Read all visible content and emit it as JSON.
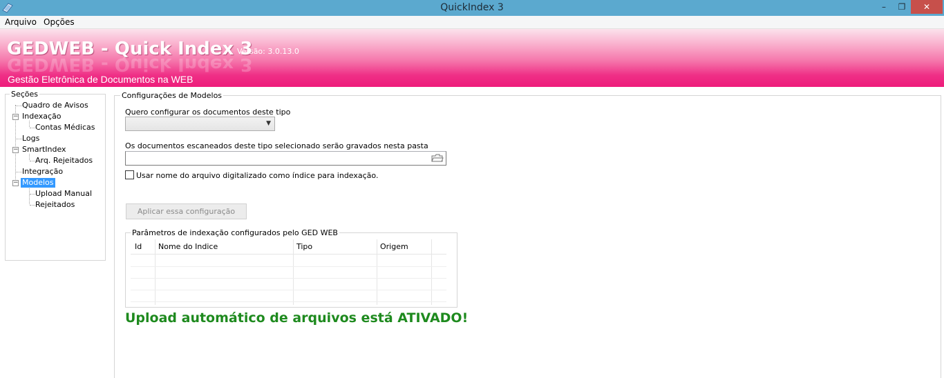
{
  "window": {
    "title": "QuickIndex 3",
    "minimize_glyph": "–",
    "maximize_glyph": "❐",
    "close_glyph": "✕"
  },
  "menu": {
    "arquivo": "Arquivo",
    "opcoes": "Opções"
  },
  "banner": {
    "title": "GEDWEB - Quick Index 3",
    "version": "Versão:  3.0.13.0",
    "subtitle": "Gestão Eletrônica de Documentos na WEB"
  },
  "sidebar": {
    "legend": "Seções",
    "items": [
      {
        "label": "Quadro de Avisos"
      },
      {
        "label": "Indexação",
        "expander": "−"
      },
      {
        "label": "Contas Médicas"
      },
      {
        "label": "Logs"
      },
      {
        "label": "SmartIndex",
        "expander": "−"
      },
      {
        "label": "Arq. Rejeitados"
      },
      {
        "label": "Integração"
      },
      {
        "label": "Modelos",
        "expander": "−",
        "selected": true
      },
      {
        "label": "Upload Manual"
      },
      {
        "label": "Rejeitados"
      }
    ]
  },
  "main": {
    "legend": "Configurações de Modelos",
    "doc_type_label": "Quero configurar os documentos deste tipo",
    "doc_type_value": "",
    "folder_label": "Os documentos escaneados deste tipo selecionado serão gravados nesta pasta",
    "folder_value": "",
    "use_filename_label": "Usar nome do arquivo digitalizado como índice para indexação.",
    "use_filename_checked": false,
    "apply_button": "Aplicar essa configuração",
    "params_legend": "Parâmetros de indexação configurados pelo GED WEB",
    "grid_columns": [
      "Id",
      "Nome do Indice",
      "Tipo",
      "Origem"
    ],
    "upload_status": "Upload automático de arquivos está ATIVADO!",
    "status_color": "#1e8a1e"
  },
  "colors": {
    "titlebar": "#5ba9cf",
    "banner_pink": "#ee1c7b",
    "selection": "#3399ff"
  }
}
